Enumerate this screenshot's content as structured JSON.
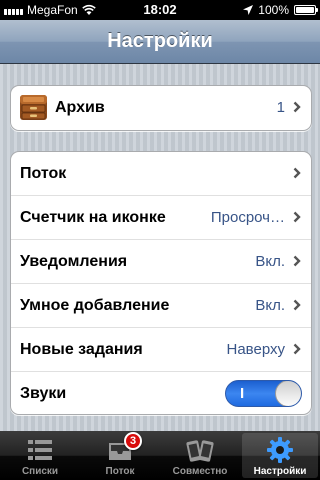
{
  "status_bar": {
    "carrier": "MegaFon",
    "time": "18:02",
    "battery_percent": "100%",
    "battery_level": 1.0
  },
  "nav": {
    "title": "Настройки"
  },
  "archive": {
    "label": "Архив",
    "count": "1",
    "icon": "archive-box-icon"
  },
  "settings": [
    {
      "label": "Поток",
      "value": "",
      "control": "chevron"
    },
    {
      "label": "Счетчик на иконке",
      "value": "Просроч…",
      "control": "chevron"
    },
    {
      "label": "Уведомления",
      "value": "Вкл.",
      "control": "chevron"
    },
    {
      "label": "Умное добавление",
      "value": "Вкл.",
      "control": "chevron"
    },
    {
      "label": "Новые задания",
      "value": "Наверху",
      "control": "chevron"
    },
    {
      "label": "Звуки",
      "value": "",
      "control": "toggle",
      "toggle_text": "I",
      "toggle_on": true
    }
  ],
  "tabs": [
    {
      "label": "Списки",
      "icon": "list-icon",
      "selected": false
    },
    {
      "label": "Поток",
      "icon": "inbox-icon",
      "badge": "3",
      "selected": false
    },
    {
      "label": "Совместно",
      "icon": "devices-icon",
      "selected": false
    },
    {
      "label": "Настройки",
      "icon": "gear-icon",
      "selected": true
    }
  ],
  "colors": {
    "value_text": "#385487",
    "toggle_on": "#2f7ae8",
    "badge": "#d80c0c"
  }
}
